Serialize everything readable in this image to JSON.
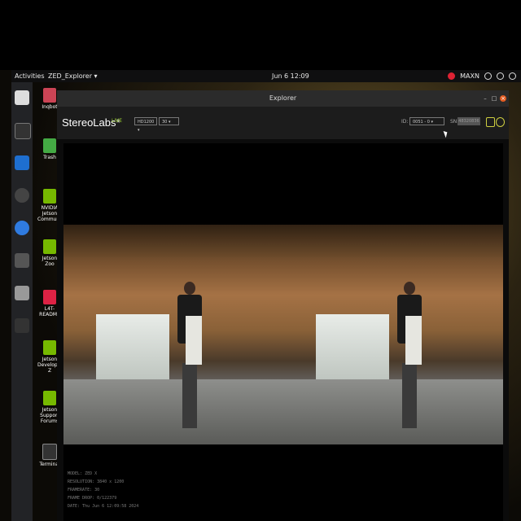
{
  "topbar": {
    "activities": "Activities",
    "app_name": "ZED_Explorer ▾",
    "clock": "Jun 6 12:09",
    "power_mode": "MAXN"
  },
  "desktop_icons": [
    {
      "label": "Inqbot"
    },
    {
      "label": "Trash"
    },
    {
      "label": "NVIDIA Jetson Community"
    },
    {
      "label": "Jetson Zoo"
    },
    {
      "label": "L4T-README"
    },
    {
      "label": "Jetson Developer Z"
    },
    {
      "label": "Jetson Support Forums"
    },
    {
      "label": "Terminal"
    }
  ],
  "window": {
    "title": "Explorer"
  },
  "toolbar": {
    "logo": "StereoLabs*",
    "live": "LIVE",
    "resolution": "HD1200 ▾",
    "fps": "30 ▾",
    "id_label": "ID:",
    "id_value": "0051 - 0 ▾",
    "sn_label": "SN:",
    "serial": "48320836"
  },
  "info": {
    "model": "MODEL: ZED X",
    "resolution": "RESOLUTION: 3840 x 1200",
    "framerate": "FRAMERATE: 30",
    "frame_drop": "FRAME DROP: 0/122379",
    "date": "DATE: Thu Jun 6 12:09:58 2024"
  }
}
